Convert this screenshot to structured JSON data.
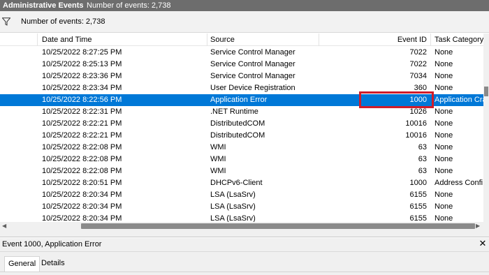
{
  "window": {
    "title": "Administrative Events",
    "event_count_label": "Number of events: 2,738"
  },
  "filter_bar": {
    "icon": "filter-icon",
    "text": "Number of events: 2,738"
  },
  "columns": [
    "Date and Time",
    "Source",
    "Event ID",
    "Task Category"
  ],
  "rows": [
    {
      "date": "10/25/2022 8:27:25 PM",
      "source": "Service Control Manager",
      "event_id": "7022",
      "task": "None"
    },
    {
      "date": "10/25/2022 8:25:13 PM",
      "source": "Service Control Manager",
      "event_id": "7022",
      "task": "None"
    },
    {
      "date": "10/25/2022 8:23:36 PM",
      "source": "Service Control Manager",
      "event_id": "7034",
      "task": "None"
    },
    {
      "date": "10/25/2022 8:23:34 PM",
      "source": "User Device Registration",
      "event_id": "360",
      "task": "None"
    },
    {
      "date": "10/25/2022 8:22:56 PM",
      "source": "Application Error",
      "event_id": "1000",
      "task": "Application Cra"
    },
    {
      "date": "10/25/2022 8:22:31 PM",
      "source": ".NET Runtime",
      "event_id": "1026",
      "task": "None"
    },
    {
      "date": "10/25/2022 8:22:21 PM",
      "source": "DistributedCOM",
      "event_id": "10016",
      "task": "None"
    },
    {
      "date": "10/25/2022 8:22:21 PM",
      "source": "DistributedCOM",
      "event_id": "10016",
      "task": "None"
    },
    {
      "date": "10/25/2022 8:22:08 PM",
      "source": "WMI",
      "event_id": "63",
      "task": "None"
    },
    {
      "date": "10/25/2022 8:22:08 PM",
      "source": "WMI",
      "event_id": "63",
      "task": "None"
    },
    {
      "date": "10/25/2022 8:22:08 PM",
      "source": "WMI",
      "event_id": "63",
      "task": "None"
    },
    {
      "date": "10/25/2022 8:20:51 PM",
      "source": "DHCPv6-Client",
      "event_id": "1000",
      "task": "Address Confi"
    },
    {
      "date": "10/25/2022 8:20:34 PM",
      "source": "LSA (LsaSrv)",
      "event_id": "6155",
      "task": "None"
    },
    {
      "date": "10/25/2022 8:20:34 PM",
      "source": "LSA (LsaSrv)",
      "event_id": "6155",
      "task": "None"
    },
    {
      "date": "10/25/2022 8:20:34 PM",
      "source": "LSA (LsaSrv)",
      "event_id": "6155",
      "task": "None"
    }
  ],
  "selected_row_index": 4,
  "colors": {
    "selection": "#0078d7",
    "highlight_box": "#d01c2a",
    "titlebar": "#6d6d6d"
  },
  "detail": {
    "title": "Event 1000, Application Error",
    "close_icon": "close-icon",
    "tabs": [
      "General",
      "Details"
    ],
    "active_tab": "General"
  }
}
